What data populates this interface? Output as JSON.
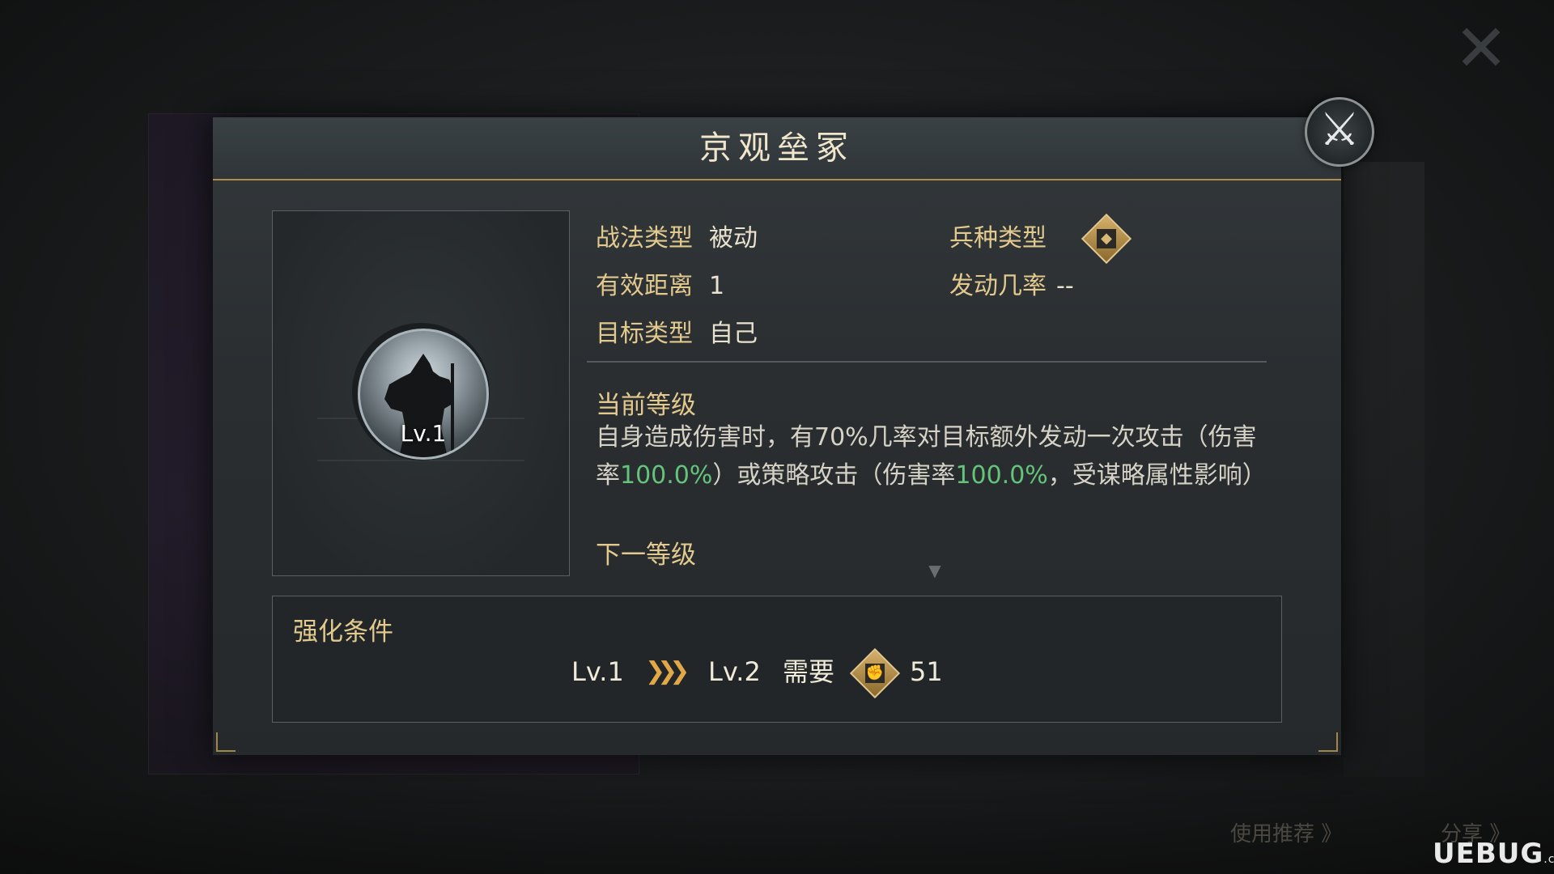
{
  "dialog": {
    "title": "京观垒冢",
    "close_icon": "crossed-swords-icon"
  },
  "portrait": {
    "level": "Lv.1"
  },
  "info": {
    "skill_type_label": "战法类型",
    "skill_type_value": "被动",
    "troop_type_label": "兵种类型",
    "troop_type_icon": "troop-shield-icon",
    "range_label": "有效距离",
    "range_value": "1",
    "trigger_rate_label": "发动几率",
    "trigger_rate_value": "--",
    "target_label": "目标类型",
    "target_value": "自己"
  },
  "levels": {
    "current_label": "当前等级",
    "desc_part1": "自身造成伤害时，有70%几率对目标额外发动一次攻击（伤害率",
    "desc_rate1": "100.0%",
    "desc_part2": "）或策略攻击（伤害率",
    "desc_rate2": "100.0%",
    "desc_part3": "，受谋略属性影响）",
    "next_label": "下一等级"
  },
  "upgrade": {
    "title": "强化条件",
    "from_level": "Lv.1",
    "to_level": "Lv.2",
    "need_label": "需要",
    "cost_icon": "fist-token-icon",
    "cost_value": "51"
  },
  "background": {
    "bottom_left_text": "使用推荐 》",
    "bottom_right_text": "分享 》",
    "watermark": "UEBUG",
    "watermark_suffix": ".com"
  },
  "colors": {
    "accent_gold": "#e2c98e",
    "header_line": "#b08c4c",
    "highlight_green": "#63c47a"
  }
}
